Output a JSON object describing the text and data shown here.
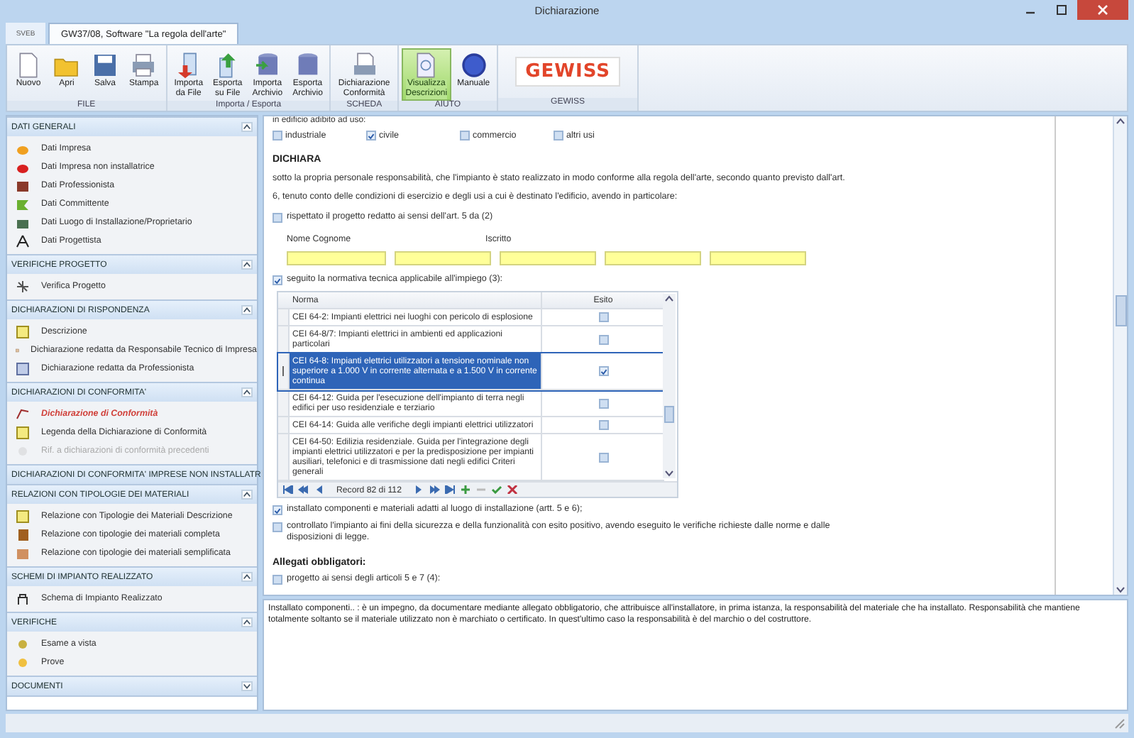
{
  "window": {
    "title": "Dichiarazione"
  },
  "app_button": {
    "label": "SVEB"
  },
  "ribbon_tabs": [
    {
      "label": "GW37/08, Software \"La regola dell'arte\"",
      "selected": true
    }
  ],
  "ribbon_groups": [
    {
      "label": "FILE",
      "buttons": [
        {
          "label": "Nuovo",
          "kind": "new",
          "selected": false
        },
        {
          "label": "Apri",
          "kind": "open",
          "selected": false
        },
        {
          "label": "Salva",
          "kind": "save",
          "selected": false
        },
        {
          "label": "Stampa",
          "kind": "print",
          "selected": false
        }
      ]
    },
    {
      "label": "Importa / Esporta",
      "buttons": [
        {
          "label": "Importa\nda File",
          "kind": "import",
          "selected": false
        },
        {
          "label": "Esporta\nsu File",
          "kind": "export",
          "selected": false
        },
        {
          "label": "Importa\nArchivio",
          "kind": "dbin",
          "selected": false
        },
        {
          "label": "Esporta\nArchivio",
          "kind": "dbout",
          "selected": false
        }
      ]
    },
    {
      "label": "SCHEDA",
      "buttons": [
        {
          "label": "Dichiarazione\nConformità",
          "kind": "doc",
          "selected": false
        }
      ]
    },
    {
      "label": "AIUTO",
      "buttons": [
        {
          "label": "Visualizza\nDescrizioni",
          "kind": "view",
          "selected": true
        },
        {
          "label": "Manuale",
          "kind": "help",
          "selected": false
        }
      ]
    },
    {
      "label": "GEWISS",
      "buttons": [
        {
          "label": "GEWISS",
          "kind": "logo"
        }
      ]
    }
  ],
  "sidebar": {
    "sections": [
      {
        "title": "DATI GENERALI",
        "expanded": true,
        "items": [
          {
            "label": "Dati Impresa",
            "selected": false,
            "disabled": false
          },
          {
            "label": "Dati Impresa non installatrice",
            "selected": false,
            "disabled": false
          },
          {
            "label": "Dati Professionista",
            "selected": false,
            "disabled": false
          },
          {
            "label": "Dati Committente",
            "selected": false,
            "disabled": false
          },
          {
            "label": "Dati Luogo di Installazione/Proprietario",
            "selected": false,
            "disabled": false
          },
          {
            "label": "Dati Progettista",
            "selected": false,
            "disabled": false
          }
        ]
      },
      {
        "title": "VERIFICHE PROGETTO",
        "expanded": true,
        "items": [
          {
            "label": "Verifica Progetto",
            "selected": false,
            "disabled": false
          }
        ]
      },
      {
        "title": "DICHIARAZIONI DI RISPONDENZA",
        "expanded": true,
        "items": [
          {
            "label": "Descrizione",
            "selected": false,
            "disabled": false
          },
          {
            "label": "Dichiarazione redatta da Responsabile Tecnico di Impresa",
            "selected": false,
            "disabled": false
          },
          {
            "label": "Dichiarazione redatta da Professionista",
            "selected": false,
            "disabled": false
          }
        ]
      },
      {
        "title": "DICHIARAZIONI DI CONFORMITA'",
        "expanded": true,
        "items": [
          {
            "label": "Dichiarazione di Conformità",
            "selected": true,
            "disabled": false
          },
          {
            "label": "Legenda della Dichiarazione di Conformità",
            "selected": false,
            "disabled": false
          },
          {
            "label": "Rif. a dichiarazioni di conformità precedenti",
            "selected": false,
            "disabled": true
          }
        ]
      },
      {
        "title": "DICHIARAZIONI DI CONFORMITA' IMPRESE NON INSTALLATR",
        "expanded": false
      },
      {
        "title": "RELAZIONI CON TIPOLOGIE DEI MATERIALI",
        "expanded": true,
        "items": [
          {
            "label": "Relazione con Tipologie dei Materiali Descrizione",
            "selected": false,
            "disabled": false
          },
          {
            "label": "Relazione con tipologie dei materiali completa",
            "selected": false,
            "disabled": false
          },
          {
            "label": "Relazione con tipologie dei materiali semplificata",
            "selected": false,
            "disabled": false
          }
        ]
      },
      {
        "title": "SCHEMI DI IMPIANTO REALIZZATO",
        "expanded": true,
        "items": [
          {
            "label": "Schema di Impianto Realizzato",
            "selected": false,
            "disabled": false
          }
        ]
      },
      {
        "title": "VERIFICHE",
        "expanded": true,
        "items": [
          {
            "label": "Esame a vista",
            "selected": false,
            "disabled": false
          },
          {
            "label": "Prove",
            "selected": false,
            "disabled": false
          }
        ]
      },
      {
        "title": "DOCUMENTI",
        "expanded": false
      }
    ]
  },
  "form": {
    "usage_label": "in edificio adibito ad uso:",
    "usage_options": [
      {
        "label": "industriale",
        "checked": false
      },
      {
        "label": "civile",
        "checked": true
      },
      {
        "label": "commercio",
        "checked": false
      },
      {
        "label": "altri usi",
        "checked": false
      }
    ],
    "heading": "DICHIARA",
    "statement": "sotto la propria personale responsabilità, che l'impianto è stato realizzato in modo conforme alla regola dell'arte, secondo quanto previsto dall'art. 6, tenuto conto delle condizioni di esercizio e degli usi a cui è destinato l'edificio, avendo in particolare:",
    "project_check": {
      "label": "rispettato il progetto redatto ai sensi dell'art. 5 da (2)",
      "checked": false
    },
    "designer_labels": [
      "Nome Cognome",
      "Iscritto"
    ],
    "norms_check": {
      "label": "seguito la normativa tecnica applicabile all'impiego (3):",
      "checked": true
    },
    "norms_table": {
      "columns": [
        "Norma",
        "Esito"
      ],
      "rows": [
        {
          "norma": "CEI 64-2: Impianti elettrici nei luoghi con pericolo di esplosione",
          "checked": false,
          "selected": false
        },
        {
          "norma": "CEI 64-8/7: Impianti elettrici in ambienti ed applicazioni particolari",
          "checked": false,
          "selected": false
        },
        {
          "norma": "CEI 64-8: Impianti elettrici utilizzatori a tensione nominale non superiore  a 1.000 V in corrente alternata e a 1.500 V in corrente continua",
          "checked": true,
          "selected": true
        },
        {
          "norma": "CEI 64-12: Guida per l'esecuzione dell'impianto di terra negli edifici per uso residenziale e terziario",
          "checked": false,
          "selected": false
        },
        {
          "norma": "CEI 64-14: Guida alle verifiche degli impianti elettrici utilizzatori",
          "checked": false,
          "selected": false
        },
        {
          "norma": "CEI 64-50: Edilizia residenziale. Guida per l'integrazione degli impianti elettrici utilizzatori e per la predisposizione per impianti ausiliari, telefonici e di trasmissione dati negli edifici Criteri generali",
          "checked": false,
          "selected": false
        }
      ],
      "record": "Record 82 di 112"
    },
    "components_check": {
      "label": "installato componenti e materiali adatti al luogo di installazione (artt. 5 e 6);",
      "checked": true
    },
    "tested_check": {
      "label": "controllato l'impianto ai fini della sicurezza e della funzionalità con esito positivo, avendo eseguito le verifiche richieste dalle norme e dalle disposizioni di legge.",
      "checked": false
    },
    "attachments_heading": "Allegati obbligatori:",
    "attachment_check": {
      "label": "progetto ai sensi degli articoli 5 e 7 (4):",
      "checked": false
    }
  },
  "description": "Installato componenti.. : è un impegno, da documentare mediante allegato obbligatorio, che attribuisce all'installatore, in prima istanza, la responsabilità del materiale che ha installato. Responsabilità che mantiene totalmente soltanto se il materiale utilizzato non è marchiato o certificato. In quest'ultimo caso la responsabilità è del marchio o del costruttore."
}
